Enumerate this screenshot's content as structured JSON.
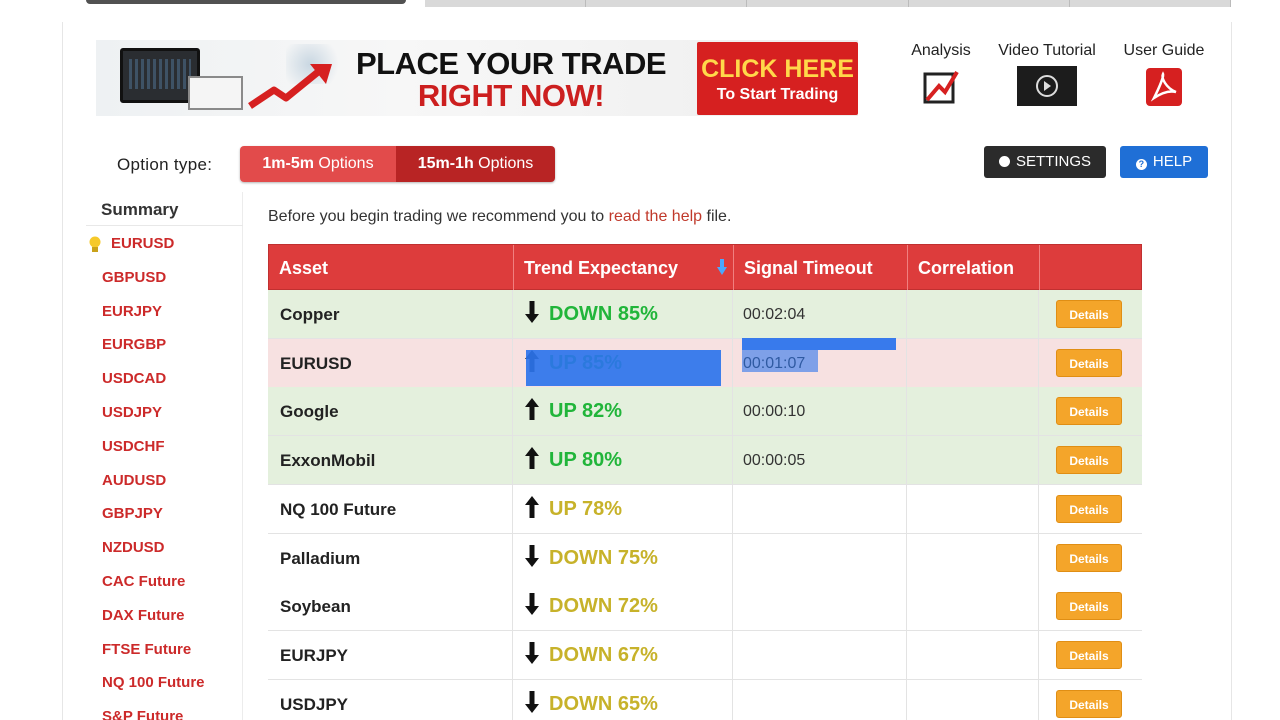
{
  "banner": {
    "line1": "PLACE YOUR TRADE",
    "line2": "RIGHT NOW!",
    "cta_line1": "CLICK HERE",
    "cta_line2": "To Start Trading"
  },
  "tools": {
    "analysis": "Analysis",
    "video": "Video Tutorial",
    "guide": "User Guide"
  },
  "options": {
    "label": "Option type:",
    "items": [
      {
        "bold": "1m-5m",
        "rest": " Options"
      },
      {
        "bold": "15m-1h",
        "rest": " Options"
      }
    ]
  },
  "buttons": {
    "settings": "SETTINGS",
    "help": "HELP"
  },
  "sidebar": {
    "summary": "Summary",
    "items": [
      "EURUSD",
      "GBPUSD",
      "EURJPY",
      "EURGBP",
      "USDCAD",
      "USDJPY",
      "USDCHF",
      "AUDUSD",
      "GBPJPY",
      "NZDUSD",
      "CAC Future",
      "DAX Future",
      "FTSE Future",
      "NQ 100 Future",
      "S&P Future"
    ]
  },
  "intro": {
    "before": "Before you begin trading we recommend you to ",
    "link": "read the help",
    "after": " file."
  },
  "table": {
    "headers": [
      "Asset",
      "Trend Expectancy",
      "Signal Timeout",
      "Correlation",
      ""
    ],
    "details_label": "Details",
    "rows": [
      {
        "asset": "Copper",
        "direction": "down",
        "trend": "DOWN 85%",
        "timeout": "00:02:04",
        "tone": "green",
        "text": "green"
      },
      {
        "asset": "EURUSD",
        "direction": "up",
        "trend": "UP 85%",
        "timeout": "00:01:07",
        "tone": "red",
        "text": "green"
      },
      {
        "asset": "Google",
        "direction": "up",
        "trend": "UP 82%",
        "timeout": "00:00:10",
        "tone": "green",
        "text": "green"
      },
      {
        "asset": "ExxonMobil",
        "direction": "up",
        "trend": "UP 80%",
        "timeout": "00:00:05",
        "tone": "green",
        "text": "green"
      },
      {
        "asset": "NQ 100 Future",
        "direction": "up",
        "trend": "UP 78%",
        "timeout": "",
        "tone": "white",
        "text": "yellow"
      },
      {
        "asset": "Palladium",
        "direction": "down",
        "trend": "DOWN 75%",
        "timeout": "",
        "tone": "white",
        "text": "yellow"
      },
      {
        "asset": "Soybean",
        "direction": "down",
        "trend": "DOWN 72%",
        "timeout": "",
        "tone": "white",
        "text": "yellow"
      },
      {
        "asset": "EURJPY",
        "direction": "down",
        "trend": "DOWN 67%",
        "timeout": "",
        "tone": "white",
        "text": "yellow"
      },
      {
        "asset": "USDJPY",
        "direction": "down",
        "trend": "DOWN 65%",
        "timeout": "",
        "tone": "white",
        "text": "yellow"
      }
    ]
  },
  "colors": {
    "header_red": "#dd3c3c",
    "trend_green": "#21b53a",
    "trend_yellow": "#c7b22a",
    "details_orange": "#f4a52a",
    "link_red": "#c0392b"
  }
}
